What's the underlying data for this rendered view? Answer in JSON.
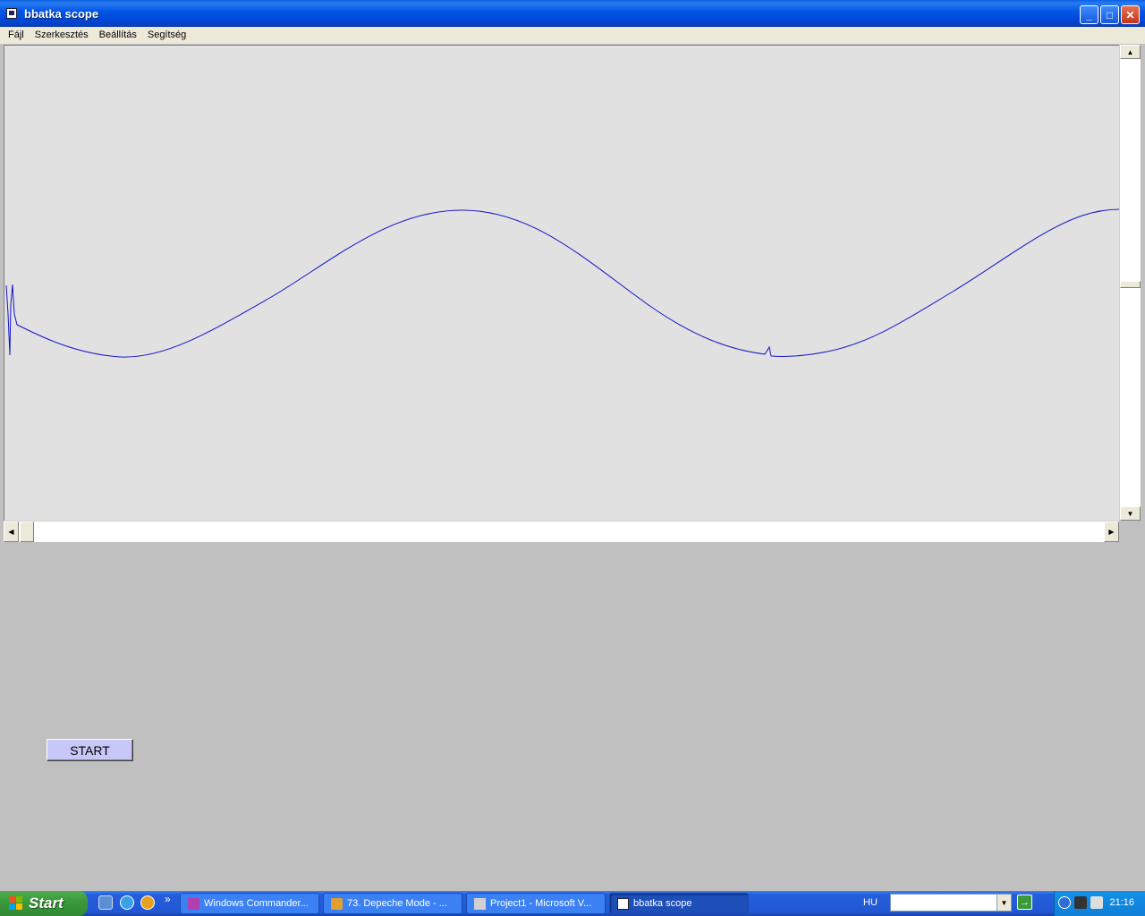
{
  "window": {
    "title": "bbatka scope",
    "minimize_glyph": "_",
    "maximize_glyph": "□",
    "close_glyph": "✕"
  },
  "menu": {
    "items": [
      "Fájl",
      "Szerkesztés",
      "Beállítás",
      "Segítség"
    ]
  },
  "scope": {
    "trace_color": "#1414c8",
    "background": "#e1e1e1"
  },
  "scrollbars": {
    "up_glyph": "▲",
    "down_glyph": "▼",
    "left_glyph": "◀",
    "right_glyph": "▶"
  },
  "controls": {
    "start_label": "START"
  },
  "taskbar": {
    "start_label": "Start",
    "quicklaunch_more": "»",
    "tasks": [
      {
        "label": "Windows Commander...",
        "active": false
      },
      {
        "label": "73. Depeche Mode - ...",
        "active": false
      },
      {
        "label": "Project1 - Microsoft V...",
        "active": false
      },
      {
        "label": "bbatka scope",
        "active": true
      }
    ],
    "language": "HU",
    "address_dropdown_glyph": "▼",
    "go_glyph": "→",
    "clock": "21:16"
  }
}
